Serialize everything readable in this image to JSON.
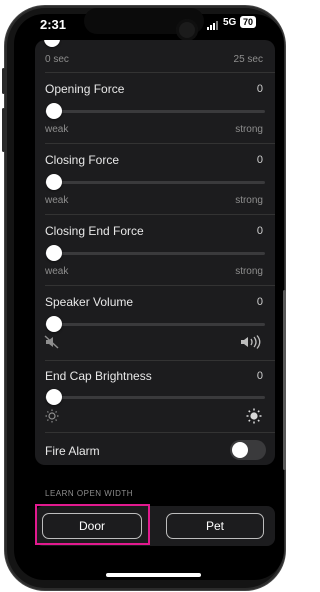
{
  "status_bar": {
    "time": "2:31",
    "network": "5G",
    "battery": "70"
  },
  "top_partial": {
    "min_label": "0 sec",
    "max_label": "25 sec"
  },
  "settings": [
    {
      "title": "Opening Force",
      "value": "0",
      "min_label": "weak",
      "max_label": "strong",
      "level": 0
    },
    {
      "title": "Closing Force",
      "value": "0",
      "min_label": "weak",
      "max_label": "strong",
      "level": 0
    },
    {
      "title": "Closing End Force",
      "value": "0",
      "min_label": "weak",
      "max_label": "strong",
      "level": 0
    },
    {
      "title": "Speaker Volume",
      "value": "0",
      "min_icon": "speaker-muted-icon",
      "max_icon": "speaker-loud-icon",
      "level": 0
    },
    {
      "title": "End Cap Brightness",
      "value": "0",
      "min_icon": "sun-dim-icon",
      "max_icon": "sun-bright-icon",
      "level": 0
    }
  ],
  "fire_alarm": {
    "label": "Fire Alarm",
    "enabled": false
  },
  "learn_open_width": {
    "section_label": "LEARN OPEN WIDTH",
    "door_button": "Door",
    "pet_button": "Pet"
  },
  "colors": {
    "highlight": "#e21a8f",
    "background": "#000000",
    "card": "#1c1c1e"
  }
}
